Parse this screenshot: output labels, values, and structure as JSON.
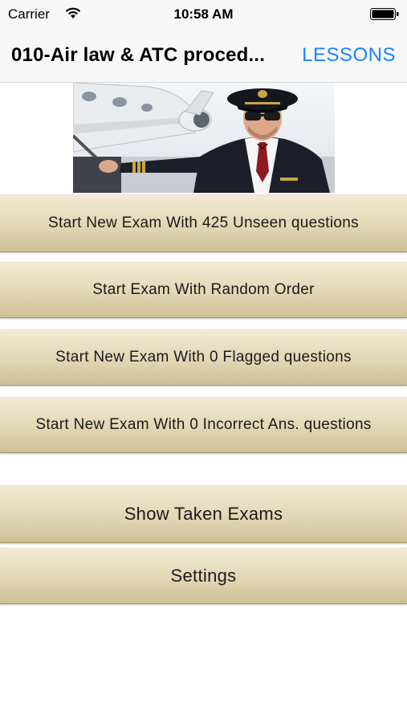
{
  "status_bar": {
    "carrier": "Carrier",
    "time": "10:58 AM"
  },
  "nav": {
    "title": "010-Air law & ATC proced...",
    "right_button": "LESSONS"
  },
  "hero_image": {
    "description_icon": "pilot-image"
  },
  "buttons": [
    {
      "label": "Start New Exam With 425 Unseen questions"
    },
    {
      "label": "Start Exam With Random Order"
    },
    {
      "label": "Start New Exam With 0 Flagged questions"
    },
    {
      "label": "Start New Exam With 0 Incorrect Ans. questions"
    },
    {
      "label": "Show Taken Exams"
    },
    {
      "label": "Settings"
    }
  ],
  "colors": {
    "accent": "#1a84ff",
    "button_top": "#f3ead5",
    "button_bottom": "#cfc095"
  }
}
